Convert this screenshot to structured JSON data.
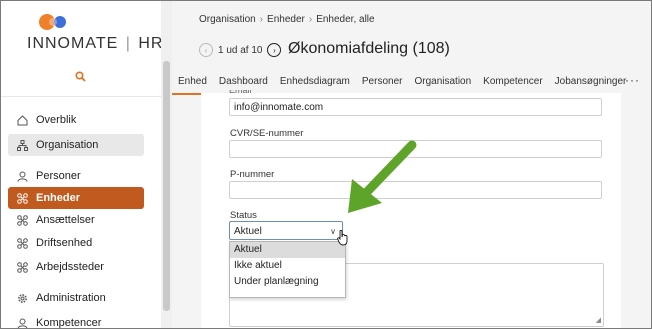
{
  "brand": {
    "name": "INNOMATE",
    "product": "HR",
    "separator": "|"
  },
  "colors": {
    "accent": "#e0731f",
    "active_nav_bg": "#c15a1f",
    "arrow": "#5fa42a"
  },
  "sidebar": {
    "items": [
      {
        "label": "Overblik",
        "icon": "home-icon"
      },
      {
        "label": "Organisation",
        "icon": "org-chart-icon"
      },
      {
        "label": "Personer",
        "icon": "person-icon"
      },
      {
        "label": "Enheder",
        "icon": "units-icon"
      },
      {
        "label": "Ansættelser",
        "icon": "units-icon"
      },
      {
        "label": "Driftsenhed",
        "icon": "units-icon"
      },
      {
        "label": "Arbejdssteder",
        "icon": "units-icon"
      },
      {
        "label": "Administration",
        "icon": "gear-icon"
      },
      {
        "label": "Kompetencer",
        "icon": "person-icon"
      }
    ]
  },
  "header": {
    "breadcrumb": [
      "Organisation",
      "Enheder",
      "Enheder, alle"
    ],
    "pager": "1 ud af 10",
    "title": "Økonomiafdeling (108)",
    "tabs": [
      "Enhed",
      "Dashboard",
      "Enhedsdiagram",
      "Personer",
      "Organisation",
      "Kompetencer",
      "Jobansøgninger"
    ],
    "more": "···"
  },
  "form": {
    "cut_label": "Email",
    "email_value": "info@innomate.com",
    "cvr_label": "CVR/SE-nummer",
    "cvr_value": "",
    "pnummer_label": "P-nummer",
    "pnummer_value": "",
    "status_label": "Status",
    "status_value": "Aktuel",
    "status_options": [
      "Aktuel",
      "Ikke aktuel",
      "Under planlægning"
    ]
  }
}
